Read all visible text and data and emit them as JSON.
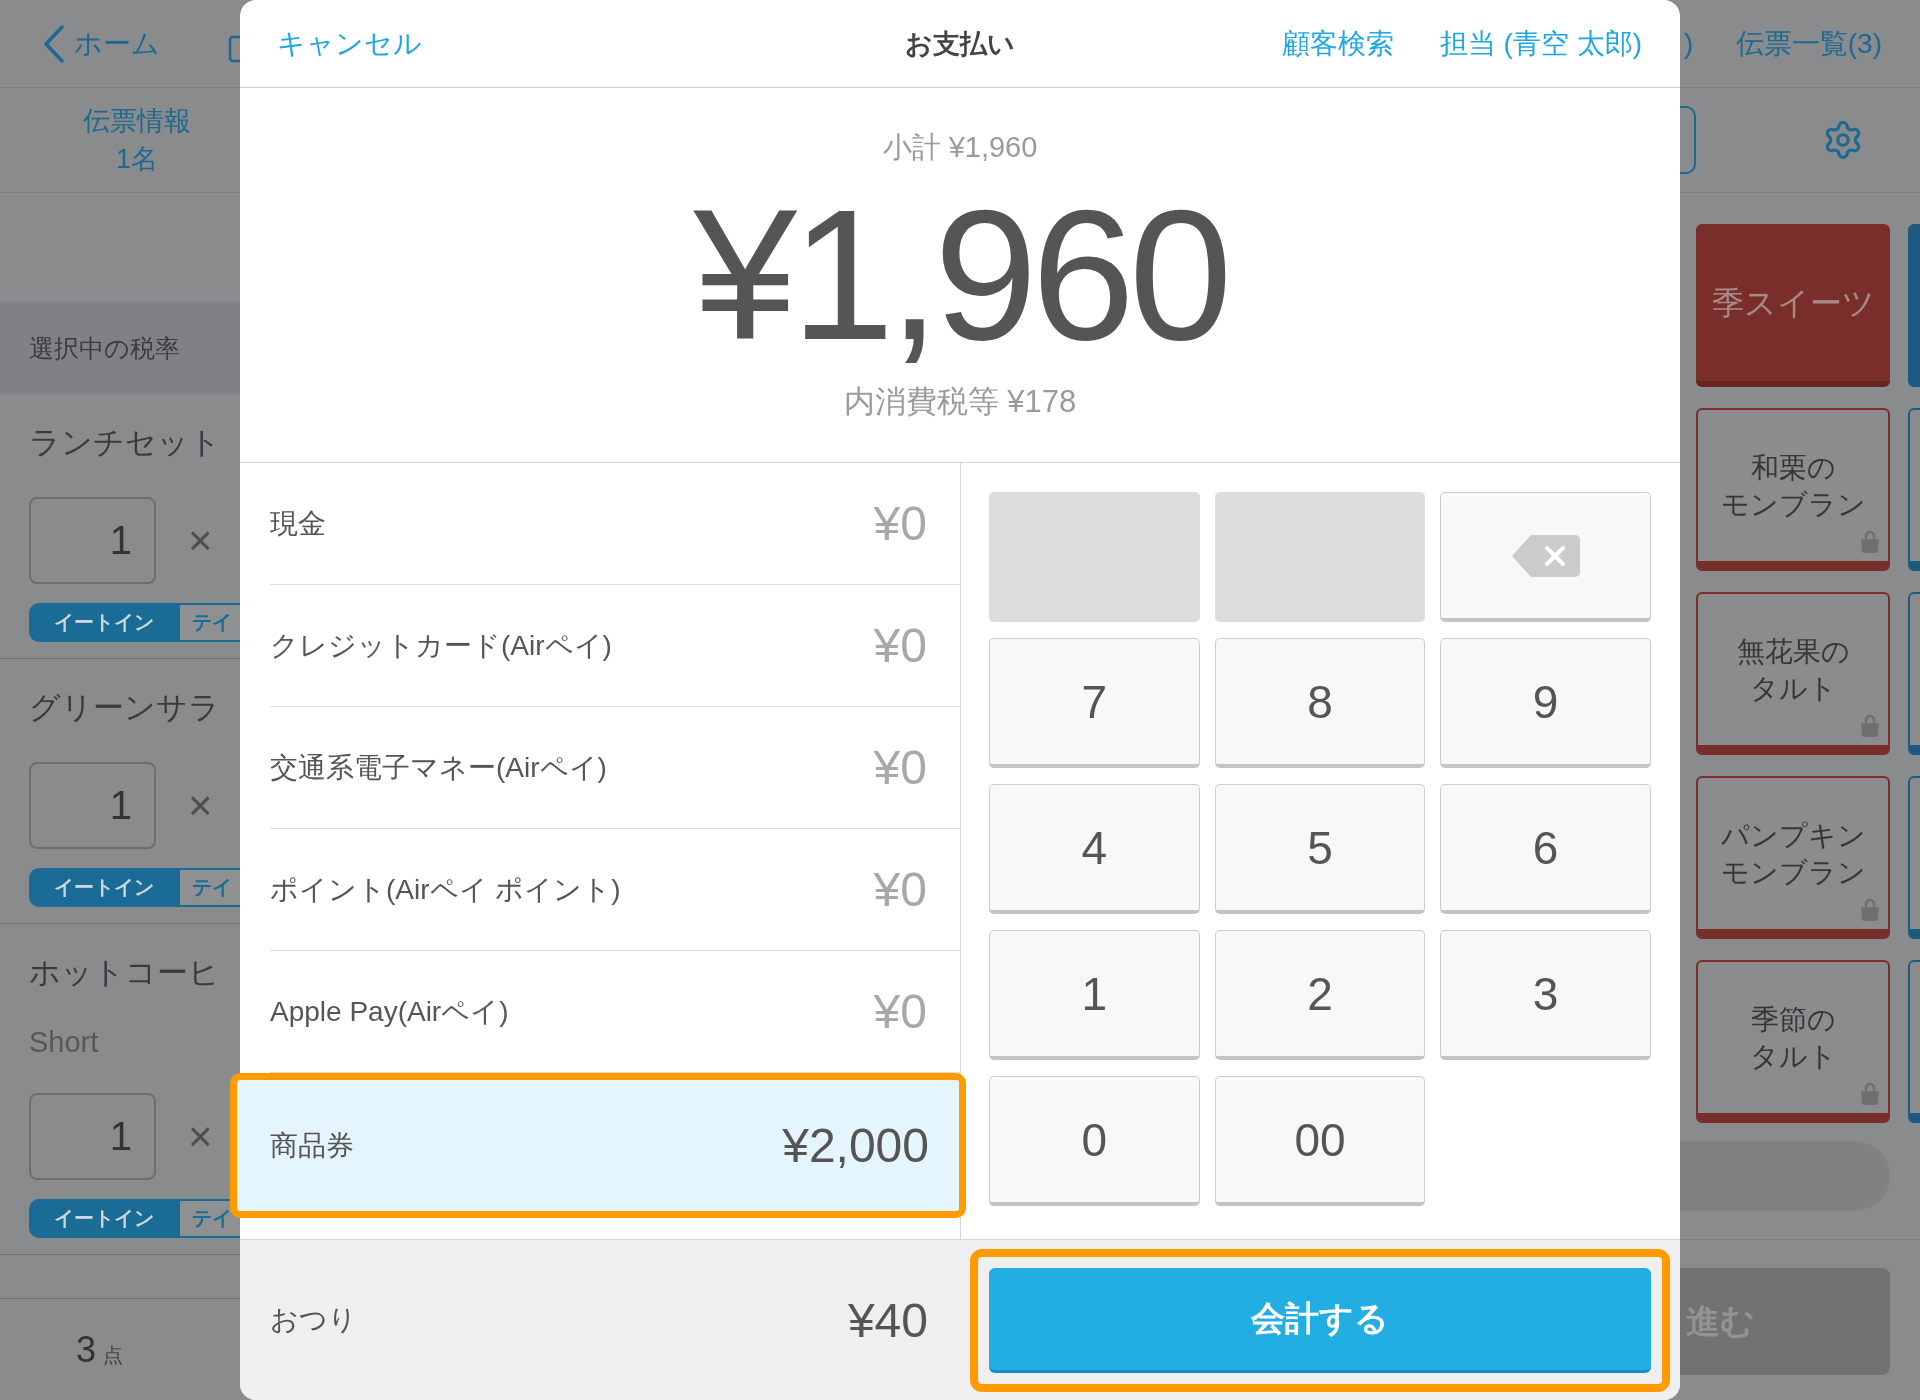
{
  "background_app": {
    "top_bar": {
      "back_label": "ホーム",
      "hidden_fragment": ")",
      "slip_list_label": "伝票一覧(3)"
    },
    "slip_info": {
      "title": "伝票情報",
      "guests": "1名"
    },
    "tax_rate_label": "選択中の税率",
    "order_items": [
      {
        "name": "ランチセット",
        "quantity": "1",
        "times_sign": "×",
        "options": [
          {
            "label": "イートイン",
            "selected": true
          },
          {
            "label": "テイ",
            "selected": false
          }
        ]
      },
      {
        "name": "グリーンサラ",
        "quantity": "1",
        "times_sign": "×",
        "options": [
          {
            "label": "イートイン",
            "selected": true
          },
          {
            "label": "テイ",
            "selected": false
          }
        ]
      },
      {
        "name": "ホットコーヒ",
        "variant": "Short",
        "quantity": "1",
        "times_sign": "×",
        "options": [
          {
            "label": "イートイン",
            "selected": true
          },
          {
            "label": "テイ",
            "selected": false
          }
        ]
      }
    ],
    "item_count": {
      "number": "3",
      "unit": "点"
    },
    "menu_tiles": [
      {
        "kind": "category",
        "label": "季スイーツ"
      },
      {
        "kind": "item",
        "label": "和栗のモンブラン"
      },
      {
        "kind": "item",
        "label": "無花果のタルト"
      },
      {
        "kind": "item",
        "label": "パンプキンモンブラン"
      },
      {
        "kind": "item",
        "label": "季節のタルト"
      }
    ],
    "next_button": "進む"
  },
  "payment_dialog": {
    "cancel": "キャンセル",
    "title": "お支払い",
    "header_links": [
      "顧客検索",
      "担当 (青空 太郎)"
    ],
    "subtotal": "小計 ¥1,960",
    "total": "¥1,960",
    "tax_included": "内消費税等 ¥178",
    "methods": [
      {
        "name": "現金",
        "amount": "¥0",
        "selected": false,
        "outlined": false
      },
      {
        "name": "クレジットカード(Airペイ)",
        "amount": "¥0",
        "selected": false,
        "outlined": false
      },
      {
        "name": "交通系電子マネー(Airペイ)",
        "amount": "¥0",
        "selected": false,
        "outlined": false
      },
      {
        "name": "ポイント(Airペイ ポイント)",
        "amount": "¥0",
        "selected": false,
        "outlined": false
      },
      {
        "name": "Apple Pay(Airペイ)",
        "amount": "¥0",
        "selected": false,
        "outlined": false
      },
      {
        "name": "商品券",
        "amount": "¥2,000",
        "selected": true,
        "outlined": true
      }
    ],
    "keypad": [
      {
        "kind": "blank"
      },
      {
        "kind": "blank"
      },
      {
        "kind": "backspace"
      },
      {
        "kind": "digit",
        "label": "7"
      },
      {
        "kind": "digit",
        "label": "8"
      },
      {
        "kind": "digit",
        "label": "9"
      },
      {
        "kind": "digit",
        "label": "4"
      },
      {
        "kind": "digit",
        "label": "5"
      },
      {
        "kind": "digit",
        "label": "6"
      },
      {
        "kind": "digit",
        "label": "1"
      },
      {
        "kind": "digit",
        "label": "2"
      },
      {
        "kind": "digit",
        "label": "3"
      },
      {
        "kind": "digit",
        "label": "0"
      },
      {
        "kind": "digit",
        "label": "00"
      }
    ],
    "change": {
      "label": "おつり",
      "amount": "¥40"
    },
    "checkout_button": {
      "label": "会計する",
      "outlined": true
    }
  }
}
